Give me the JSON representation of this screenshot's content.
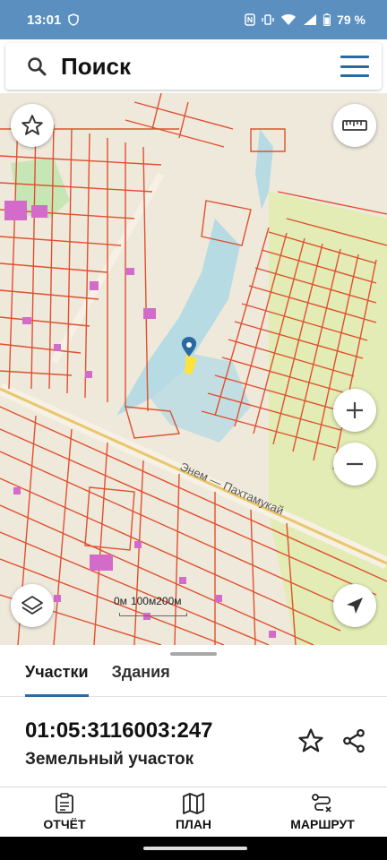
{
  "status_bar": {
    "time": "13:01",
    "battery": "79 %"
  },
  "header": {
    "title": "Поиск"
  },
  "map": {
    "scale": {
      "label_0": "0м",
      "label_1": "100м",
      "label_2": "200м"
    },
    "street_labels": [
      "Энем — Пахтамукай"
    ],
    "colors": {
      "parcel_border": "#e0502e",
      "water": "#b7dbe3",
      "field": "#e2ecb4",
      "background": "#efe9dc",
      "building": "#d26bc9"
    }
  },
  "sheet": {
    "tabs": [
      {
        "label": "Участки",
        "active": true
      },
      {
        "label": "Здания",
        "active": false
      }
    ],
    "parcel_number": "01:05:3116003:247",
    "parcel_type": "Земельный участок"
  },
  "bottom_nav": [
    {
      "label": "ОТЧЁТ",
      "icon": "report-icon"
    },
    {
      "label": "ПЛАН",
      "icon": "map-plan-icon"
    },
    {
      "label": "МАРШРУТ",
      "icon": "route-icon"
    }
  ],
  "accent_color": "#2a6aa3"
}
